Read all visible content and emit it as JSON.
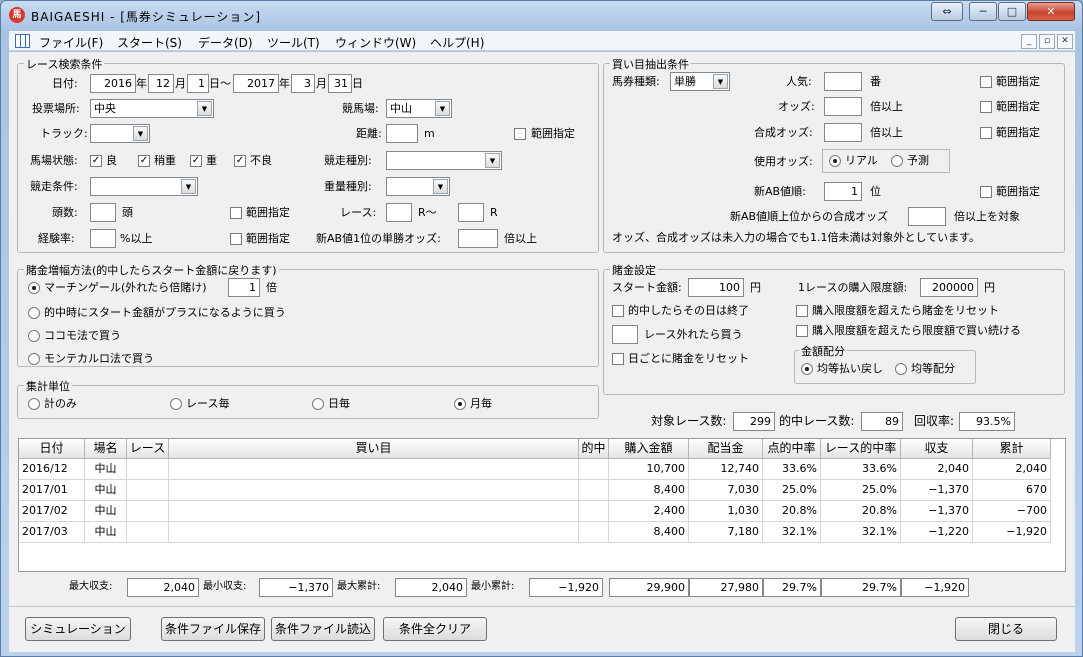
{
  "window": {
    "title": "BAIGAESHI - [馬券シミュレーション]",
    "app_icon": "馬",
    "restore": "⇔",
    "min": "─",
    "max": "□",
    "close": "✕"
  },
  "menu": {
    "items": [
      "ファイル(F)",
      "スタート(S)",
      "データ(D)",
      "ツール(T)",
      "ウィンドウ(W)",
      "ヘルプ(H)"
    ],
    "mdi": [
      "_",
      "▫",
      "✕"
    ]
  },
  "race": {
    "legend": "レース検索条件",
    "date_label": "日付:",
    "from_year": "2016",
    "from_month": "12",
    "from_day": "1",
    "to_year": "2017",
    "to_month": "3",
    "to_day": "31",
    "u_year": "年",
    "u_month": "月",
    "u_day_to": "日〜",
    "u_day": "日",
    "venue_label": "投票場所:",
    "venue": "中央",
    "course_label": "競馬場:",
    "course": "中山",
    "track_label": "トラック:",
    "track": "",
    "distance_label": "距離:",
    "distance": "",
    "distance_unit": "m",
    "distance_range": "範囲指定",
    "condition_label": "馬場状態:",
    "conditions": [
      "良",
      "稍重",
      "重",
      "不良"
    ],
    "type_label": "競走種別:",
    "type": "",
    "race_cond_label": "競走条件:",
    "race_cond": "",
    "weight_label": "重量種別:",
    "weight": "",
    "heads_label": "頭数:",
    "heads": "",
    "heads_unit": "頭",
    "heads_range": "範囲指定",
    "race_label": "レース:",
    "race_from": "",
    "race_mid": "R〜",
    "race_to": "",
    "race_unit": "R",
    "exp_label": "経験率:",
    "exp": "",
    "exp_unit": "%以上",
    "exp_range": "範囲指定",
    "ab_win_label": "新AB値1位の単勝オッズ:",
    "ab_win": "",
    "ab_win_unit": "倍以上"
  },
  "pick": {
    "legend": "買い目抽出条件",
    "kind_label": "馬券種類:",
    "kind": "単勝",
    "pop_label": "人気:",
    "pop": "",
    "pop_unit": "番",
    "pop_range": "範囲指定",
    "odds_label": "オッズ:",
    "odds": "",
    "odds_unit": "倍以上",
    "odds_range": "範囲指定",
    "combo_label": "合成オッズ:",
    "combo": "",
    "combo_unit": "倍以上",
    "combo_range": "範囲指定",
    "use_label": "使用オッズ:",
    "use_real": "リアル",
    "use_pred": "予測",
    "ab_rank_label": "新AB値順:",
    "ab_rank": "1",
    "ab_rank_unit": "位",
    "ab_rank_range": "範囲指定",
    "ab_combo_label": "新AB値順上位からの合成オッズ",
    "ab_combo": "",
    "ab_combo_unit": "倍以上を対象",
    "note": "オッズ、合成オッズは未入力の場合でも1.1倍未満は対象外としています。"
  },
  "increase": {
    "legend": "賭金増幅方法(的中したらスタート金額に戻ります)",
    "martingale": "マーチンゲール(外れたら倍賭け)",
    "mult": "1",
    "mult_unit": "倍",
    "plus": "的中時にスタート金額がプラスになるように買う",
    "cocomo": "ココモ法で買う",
    "montecarlo": "モンテカルロ法で買う"
  },
  "bet": {
    "legend": "賭金設定",
    "start_label": "スタート金額:",
    "start": "100",
    "start_unit": "円",
    "limit_label": "1レースの購入限度額:",
    "limit": "200000",
    "limit_unit": "円",
    "stop_on_hit": "的中したらその日は終了",
    "reset_over": "購入限度額を超えたら賭金をリセット",
    "buy_after": "レース外れたら買う",
    "buy_after_value": "",
    "keep_limit": "購入限度額を超えたら限度額で買い続ける",
    "reset_daily": "日ごとに賭金をリセット",
    "alloc_legend": "金額配分",
    "alloc_equal_pay": "均等払い戻し",
    "alloc_equal": "均等配分"
  },
  "unit": {
    "legend": "集計単位",
    "opts": [
      "計のみ",
      "レース毎",
      "日毎",
      "月毎"
    ]
  },
  "stats": {
    "races_label": "対象レース数:",
    "races": "299",
    "hits_label": "的中レース数:",
    "hits": "89",
    "ret_label": "回収率:",
    "ret": "93.5%"
  },
  "table": {
    "headers": [
      "日付",
      "場名",
      "レース",
      "買い目",
      "的中",
      "購入金額",
      "配当金",
      "点的中率",
      "レース的中率",
      "収支",
      "累計"
    ],
    "rows": [
      [
        "2016/12",
        "中山",
        "",
        "",
        "",
        "10,700",
        "12,740",
        "33.6%",
        "33.6%",
        "2,040",
        "2,040"
      ],
      [
        "2017/01",
        "中山",
        "",
        "",
        "",
        "8,400",
        "7,030",
        "25.0%",
        "25.0%",
        "−1,370",
        "670"
      ],
      [
        "2017/02",
        "中山",
        "",
        "",
        "",
        "2,400",
        "1,030",
        "20.8%",
        "20.8%",
        "−1,370",
        "−700"
      ],
      [
        "2017/03",
        "中山",
        "",
        "",
        "",
        "8,400",
        "7,180",
        "32.1%",
        "32.1%",
        "−1,220",
        "−1,920"
      ]
    ]
  },
  "summary": {
    "max_inc_label": "最大収支:",
    "max_inc": "2,040",
    "min_inc_label": "最小収支:",
    "min_inc": "−1,370",
    "max_cum_label": "最大累計:",
    "max_cum": "2,040",
    "min_cum_label": "最小累計:",
    "min_cum": "−1,920",
    "buy": "29,900",
    "pay": "27,980",
    "hit": "29.7%",
    "race_hit": "29.7%",
    "total": "−1,920"
  },
  "buttons": {
    "simulate": "シミュレーション",
    "save": "条件ファイル保存",
    "load": "条件ファイル読込",
    "clear": "条件全クリア",
    "close": "閉じる"
  }
}
